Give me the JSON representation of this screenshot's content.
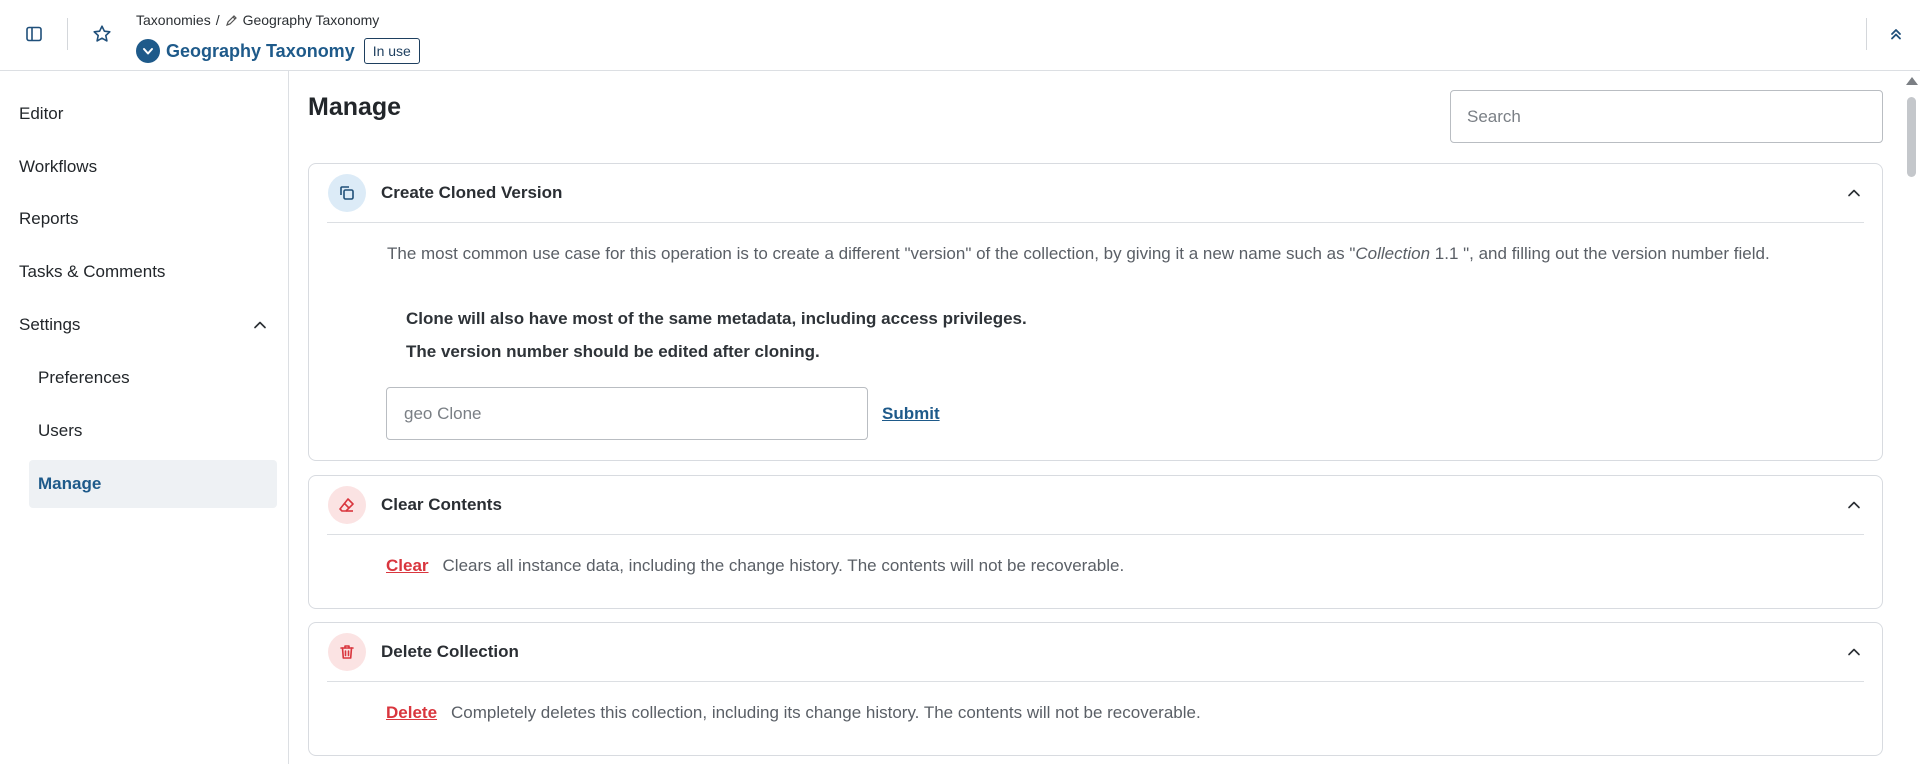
{
  "header": {
    "breadcrumb_parent": "Taxonomies",
    "breadcrumb_sep": "/",
    "breadcrumb_current": "Geography Taxonomy",
    "title": "Geography Taxonomy",
    "status_badge": "In use"
  },
  "sidebar": {
    "items": [
      {
        "label": "Editor"
      },
      {
        "label": "Workflows"
      },
      {
        "label": "Reports"
      },
      {
        "label": "Tasks & Comments"
      },
      {
        "label": "Settings"
      }
    ],
    "settings_children": [
      {
        "label": "Preferences"
      },
      {
        "label": "Users"
      },
      {
        "label": "Manage",
        "active": true
      }
    ]
  },
  "main": {
    "page_title": "Manage",
    "search_placeholder": "Search",
    "clone_card": {
      "title": "Create Cloned Version",
      "desc_part1": "The most common use case for this operation is to create a different \"version\" of the collection, by giving it a new name such as \"",
      "desc_italic": "Collection",
      "desc_part2": " 1.1 \", and filling out the version number field.",
      "note1": "Clone will also have most of the same metadata, including access privileges.",
      "note2": "The version number should be edited after cloning.",
      "input_placeholder": "geo Clone",
      "submit_label": "Submit"
    },
    "clear_card": {
      "title": "Clear Contents",
      "action_label": "Clear",
      "action_desc": "Clears all instance data, including the change history. The contents will not be recoverable."
    },
    "delete_card": {
      "title": "Delete Collection",
      "action_label": "Delete",
      "action_desc": "Completely deletes this collection, including its change history. The contents will not be recoverable."
    }
  },
  "icons": {
    "sidebar_toggle": "sidebar-toggle-icon",
    "favorite": "star-icon",
    "collapse": "chevrons-up-icon",
    "clone": "copy-icon",
    "clear": "eraser-icon",
    "delete": "trash-icon"
  },
  "colors": {
    "brand": "#1e5a8a",
    "danger": "#d9363e",
    "active_bg": "#eef1f4"
  }
}
